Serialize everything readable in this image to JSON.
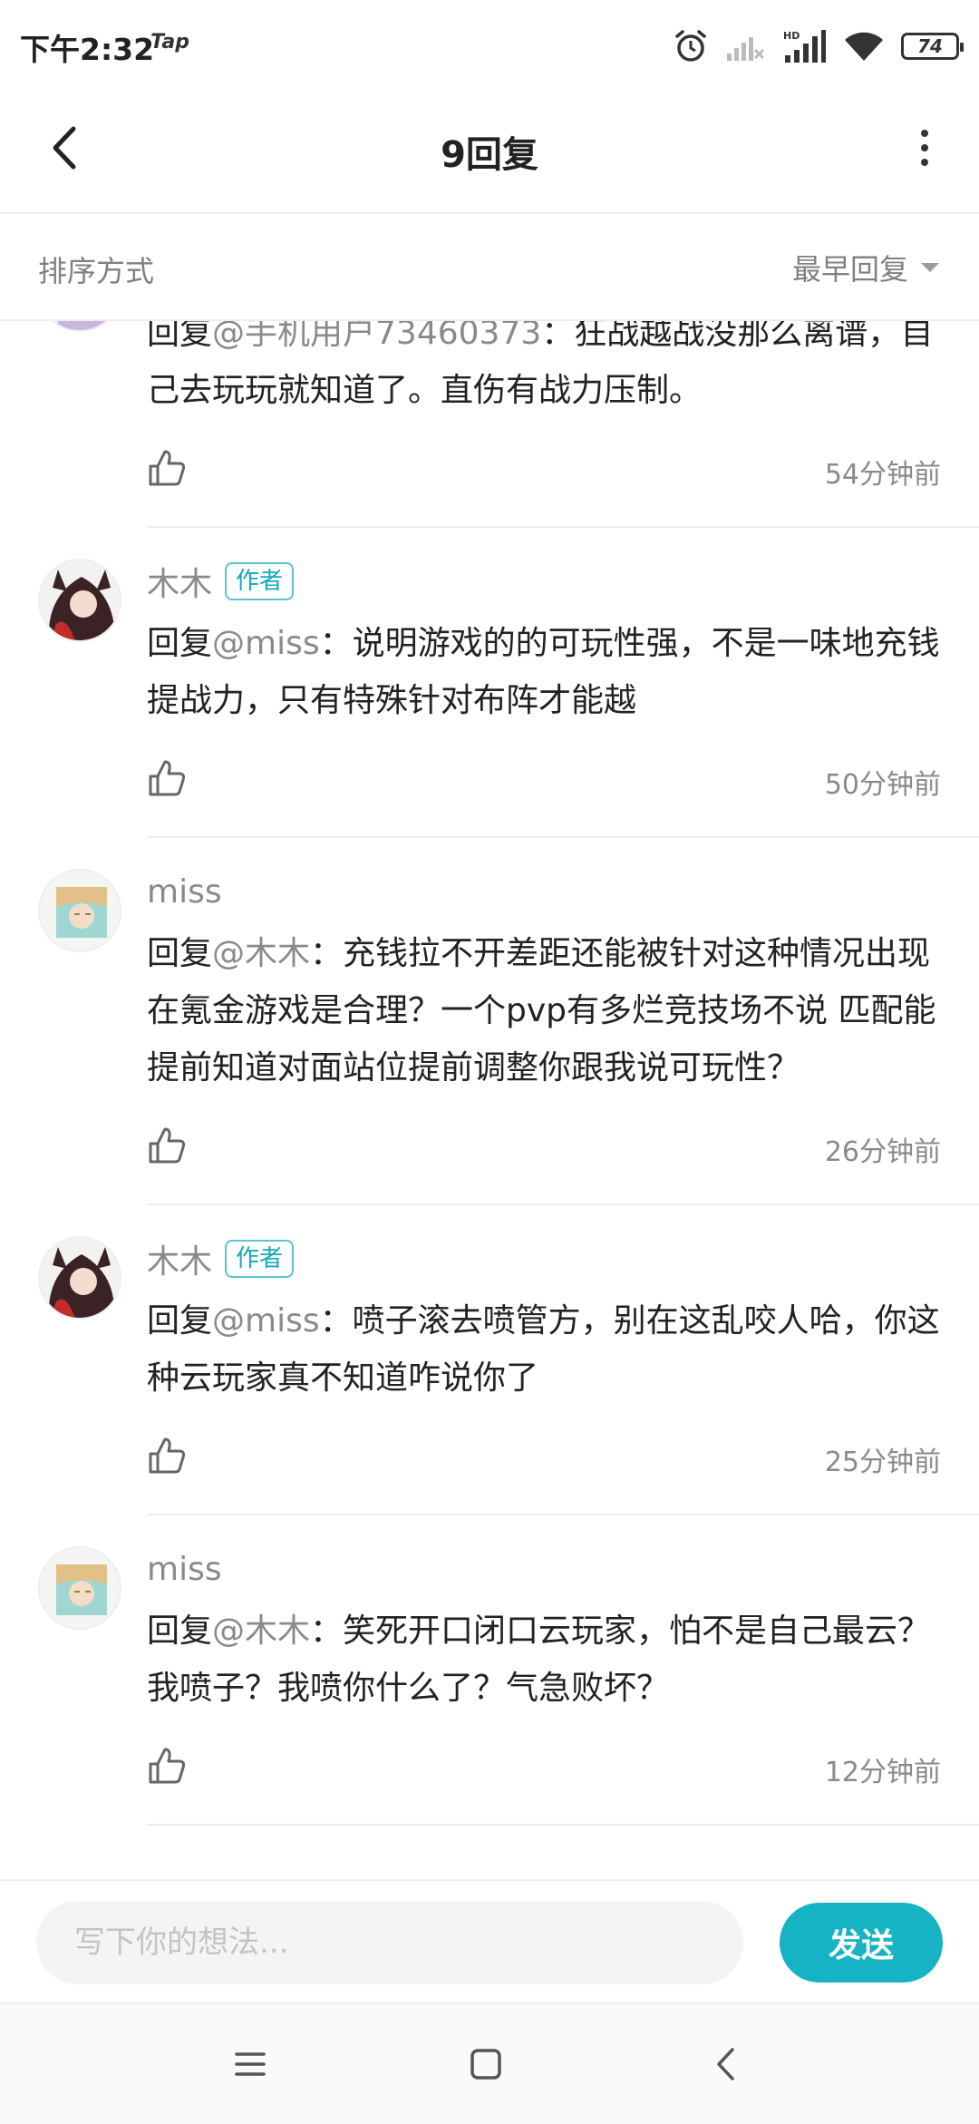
{
  "status_bar": {
    "time": "下午2:32",
    "tap_label": "Tap",
    "battery": "74"
  },
  "header": {
    "title": "9回复"
  },
  "sort": {
    "label": "排序方式",
    "selected": "最早回复"
  },
  "comments": [
    {
      "name": "",
      "is_author": false,
      "author_badge": "",
      "reply_prefix": "回复",
      "mention": "@手机用户73460373",
      "text": "：狂战越战没那么离谱，自己去玩玩就知道了。直伤有战力压制。",
      "time": "54分钟前"
    },
    {
      "name": "木木",
      "is_author": true,
      "author_badge": "作者",
      "reply_prefix": "回复",
      "mention": "@miss",
      "text": "：说明游戏的的可玩性强，不是一味地充钱提战力，只有特殊针对布阵才能越",
      "time": "50分钟前"
    },
    {
      "name": "miss",
      "is_author": false,
      "author_badge": "",
      "reply_prefix": "回复",
      "mention": "@木木",
      "text": "：充钱拉不开差距还能被针对这种情况出现在氪金游戏是合理？一个pvp有多烂竞技场不说  匹配能提前知道对面站位提前调整你跟我说可玩性？",
      "time": "26分钟前"
    },
    {
      "name": "木木",
      "is_author": true,
      "author_badge": "作者",
      "reply_prefix": "回复",
      "mention": "@miss",
      "text": "：喷子滚去喷管方，别在这乱咬人哈，你这种云玩家真不知道咋说你了",
      "time": "25分钟前"
    },
    {
      "name": "miss",
      "is_author": false,
      "author_badge": "",
      "reply_prefix": "回复",
      "mention": "@木木",
      "text": "：笑死开口闭口云玩家，怕不是自己最云？我喷子？我喷你什么了？气急败坏？",
      "time": "12分钟前"
    }
  ],
  "input": {
    "placeholder": "写下你的想法...",
    "send_label": "发送"
  },
  "colors": {
    "accent": "#16b3c4",
    "author_badge": "#15a9b9",
    "secondary_text": "#8a8a8a"
  },
  "icons": {
    "status": [
      "alarm-icon",
      "signal-off-icon",
      "hd-signal-icon",
      "wifi-icon",
      "battery-icon"
    ],
    "header": [
      "back-arrow-icon",
      "more-vertical-icon"
    ],
    "comment": "thumbs-up-icon",
    "nav": [
      "menu-icon",
      "home-square-icon",
      "back-triangle-icon"
    ]
  }
}
